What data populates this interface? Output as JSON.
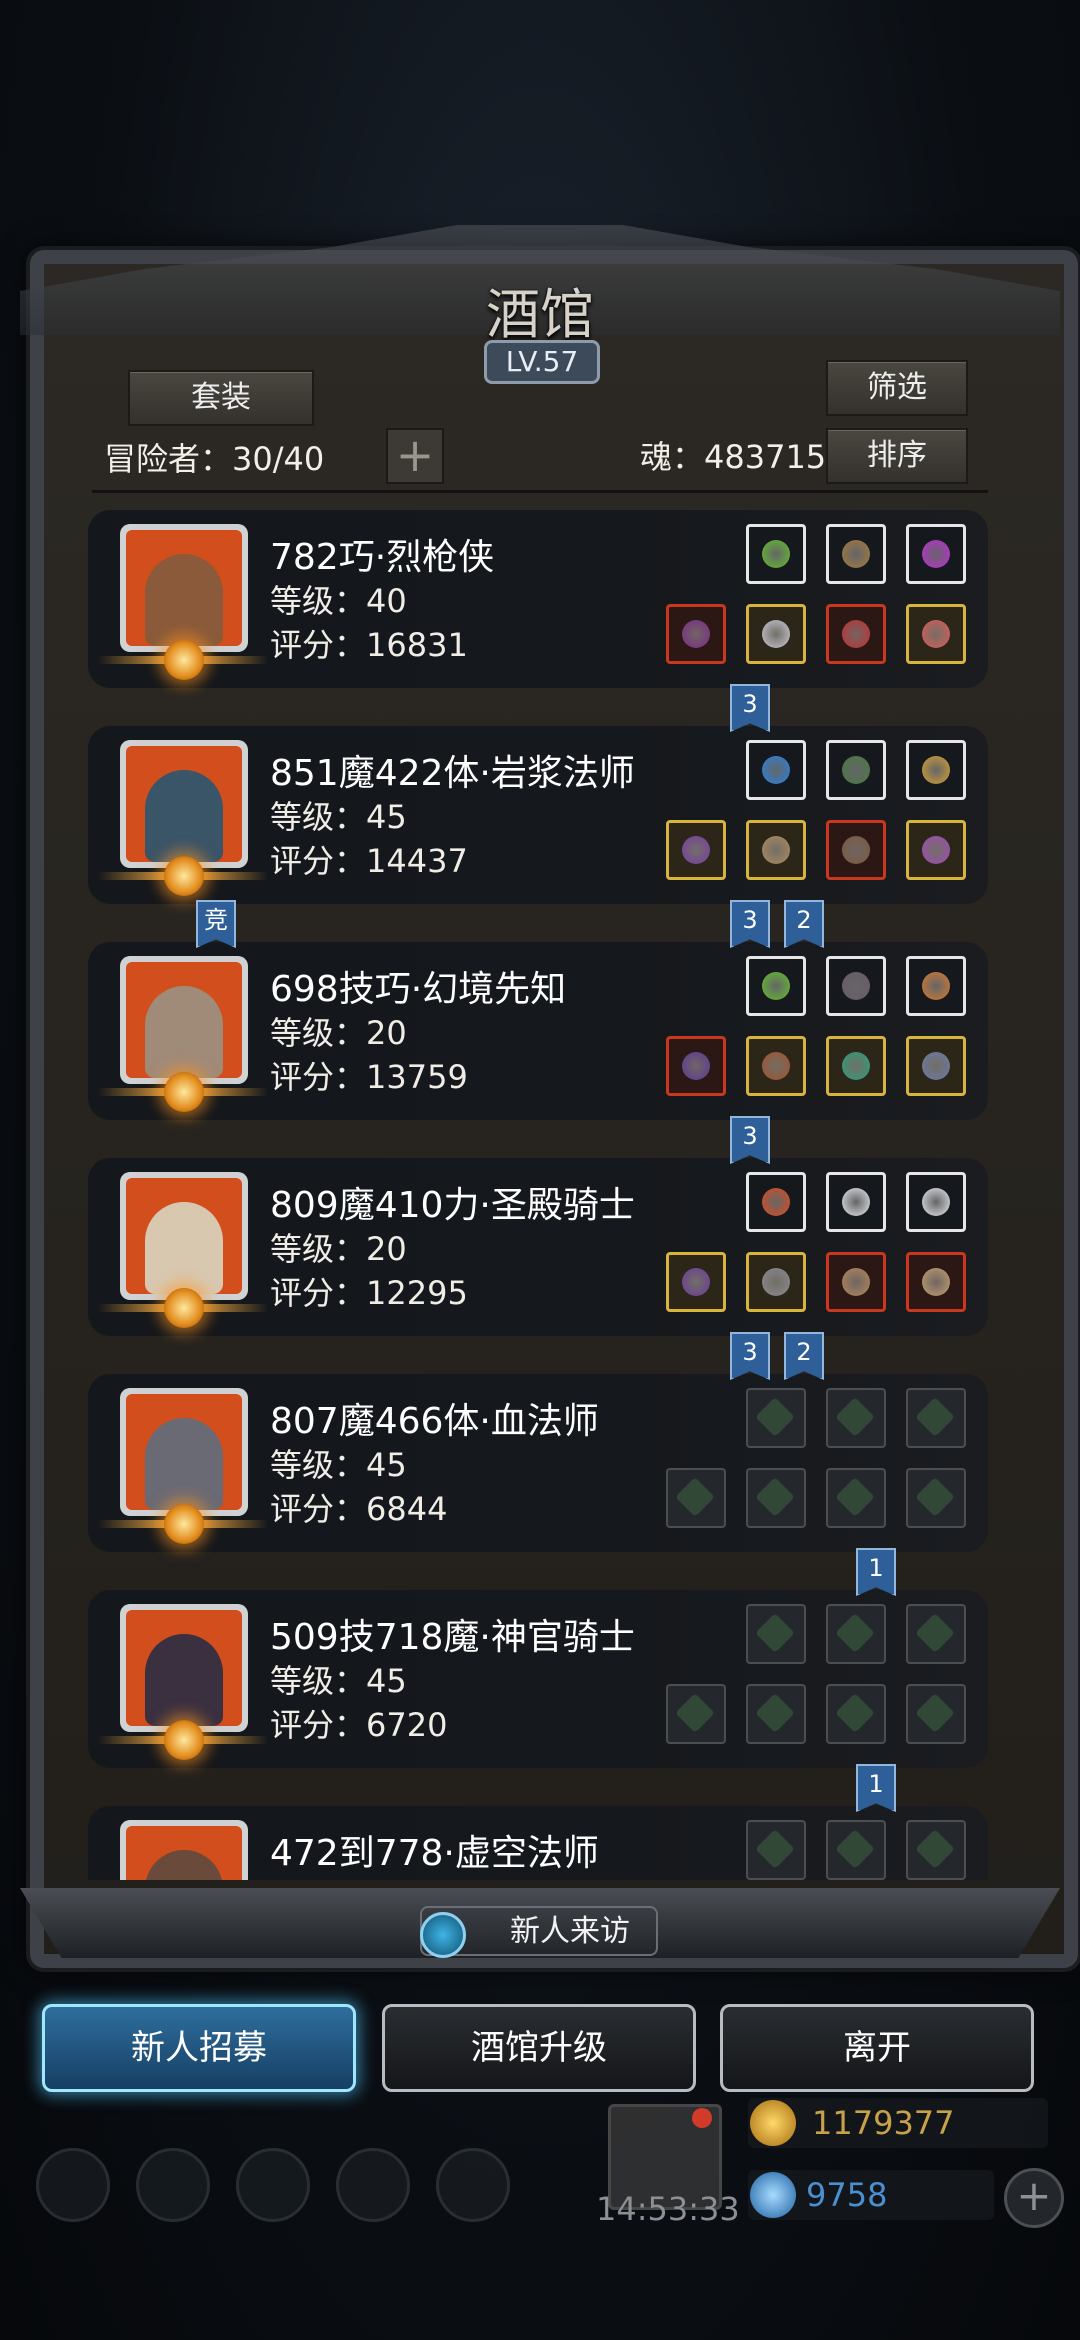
{
  "header": {
    "title": "酒馆",
    "level": "LV.57",
    "suit_button": "套装",
    "filter_button": "筛选",
    "sort_button": "排序",
    "adventurers_label": "冒险者：30/40",
    "add_icon": "plus-icon",
    "soul_label": "魂：483715"
  },
  "heroes": [
    {
      "name": "782巧·烈枪侠",
      "level": "等级：40",
      "score": "评分：16831",
      "portrait_color": "#8a5a3a",
      "gear": [
        "white",
        "white",
        "white",
        "red",
        "gold",
        "red",
        "gold"
      ],
      "gear_colors": [
        "#66c02a",
        "#a67a3a",
        "#c22bd6",
        "#7a2a8a",
        "#c9c9d6",
        "#c23030",
        "#e05a5a"
      ]
    },
    {
      "name": "851魔422体·岩浆法师",
      "level": "等级：45",
      "score": "评分：14437",
      "portrait_color": "#3a5468",
      "gear": [
        "white",
        "white",
        "white",
        "gold",
        "gold",
        "red",
        "gold"
      ],
      "gear_colors": [
        "#2a80e0",
        "#4a7a40",
        "#d8a030",
        "#7a3aa8",
        "#b08a60",
        "#7a5a40",
        "#a04ab8"
      ]
    },
    {
      "name": "698技巧·幻境先知",
      "level": "等级：20",
      "score": "评分：13759",
      "portrait_color": "#a08a78",
      "gear": [
        "white",
        "white",
        "white",
        "red",
        "gold",
        "gold",
        "gold"
      ],
      "gear_colors": [
        "#66c02a",
        "#6a5a66",
        "#d87a30",
        "#5a3a9a",
        "#a0522d",
        "#2aa07a",
        "#6a7aa8"
      ]
    },
    {
      "name": "809魔410力·圣殿骑士",
      "level": "等级：20",
      "score": "评分：12295",
      "portrait_color": "#d8c8b0",
      "gear": [
        "white",
        "white",
        "white",
        "gold",
        "gold",
        "red",
        "red"
      ],
      "gear_colors": [
        "#e04a1a",
        "#e8e8e8",
        "#e8e8e8",
        "#6a3a9a",
        "#8a8a92",
        "#b08a5a",
        "#c0a070"
      ]
    },
    {
      "name": "807魔466体·血法师",
      "level": "等级：45",
      "score": "评分：6844",
      "portrait_color": "#6a6a74",
      "gear": [
        "empty",
        "empty",
        "empty",
        "empty",
        "empty",
        "empty",
        "empty"
      ],
      "gear_colors": []
    },
    {
      "name": "509技718魔·神官骑士",
      "level": "等级：45",
      "score": "评分：6720",
      "portrait_color": "#3a3040",
      "gear": [
        "empty",
        "empty",
        "empty",
        "empty",
        "empty",
        "empty",
        "empty"
      ],
      "gear_colors": []
    },
    {
      "name": "472到778·虚空法师",
      "level": "",
      "score": "",
      "portrait_color": "#6a4a3a",
      "gear": [
        "empty",
        "empty",
        "empty"
      ],
      "gear_colors": []
    }
  ],
  "tags": [
    {
      "text": "3",
      "row": 0,
      "slot": "a"
    },
    {
      "text": "竞",
      "row": 1,
      "slot": "left"
    },
    {
      "text": "3",
      "row": 1,
      "slot": "a"
    },
    {
      "text": "2",
      "row": 1,
      "slot": "b"
    },
    {
      "text": "3",
      "row": 2,
      "slot": "a"
    },
    {
      "text": "3",
      "row": 3,
      "slot": "a"
    },
    {
      "text": "2",
      "row": 3,
      "slot": "b"
    },
    {
      "text": "1",
      "row": 4,
      "slot": "c"
    },
    {
      "text": "1",
      "row": 5,
      "slot": "c"
    }
  ],
  "visit_button": "新人来访",
  "actions": {
    "recruit": "新人招募",
    "upgrade": "酒馆升级",
    "leave": "离开"
  },
  "status": {
    "clock": "14:53:33",
    "gold": "1179377",
    "gems": "9758"
  },
  "colors": {
    "accent_blue": "#2e6e9d",
    "panel_bg": "#2c2924",
    "gold_text": "#c8a24a",
    "gem_text": "#4a8fd0"
  }
}
